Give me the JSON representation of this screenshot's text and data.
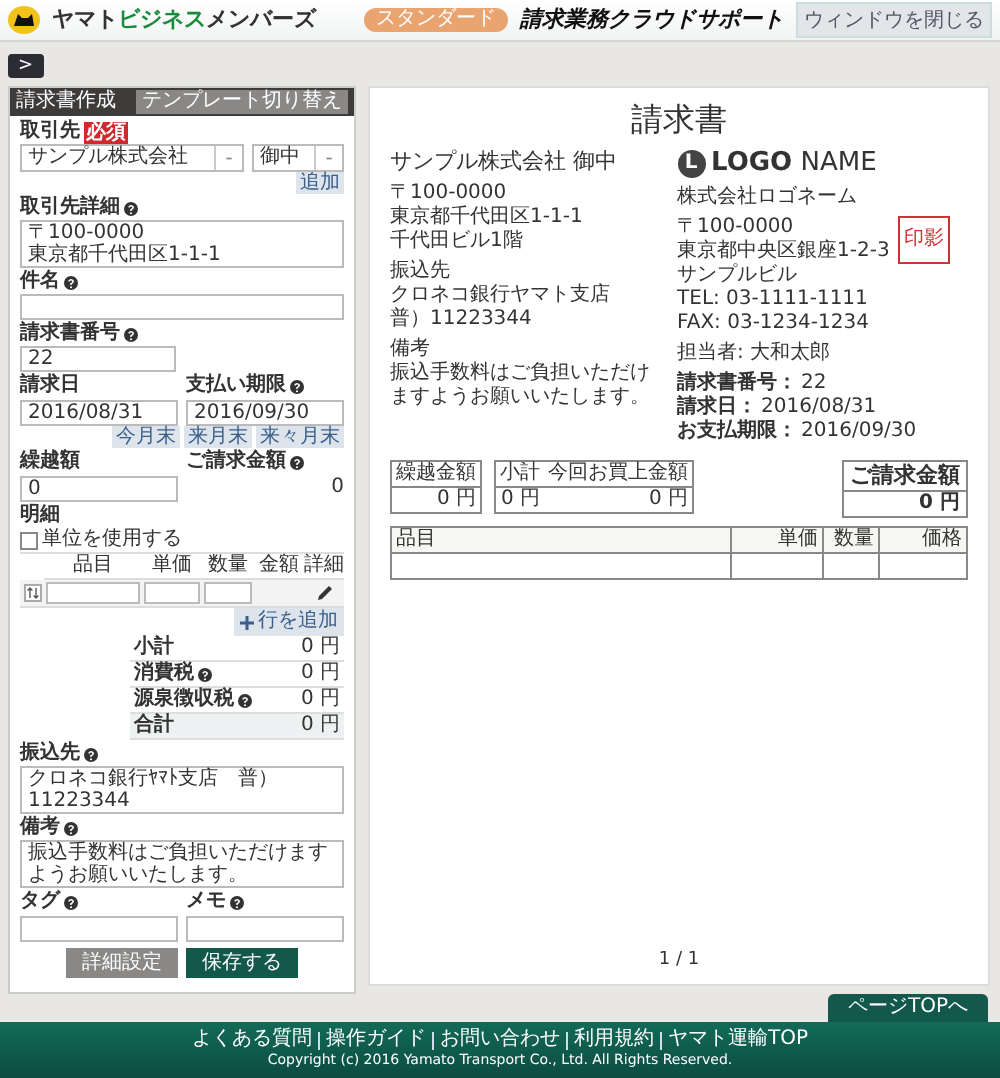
{
  "header": {
    "brand": [
      {
        "text": "ヤマト",
        "accent": false
      },
      {
        "text": "ビジネス",
        "accent": true
      },
      {
        "text": "メンバーズ",
        "accent": false
      }
    ],
    "plan": "スタンダード",
    "service": "請求業務クラウドサポート",
    "close_button": "ウィンドウを閉じる"
  },
  "panel_toggle": ">",
  "form": {
    "title": "請求書作成",
    "template_button": "テンプレート切り替え",
    "client": {
      "label": "取引先",
      "required": "必須",
      "value": "サンプル株式会社",
      "clear": "-",
      "suffix": "御中",
      "suffix_clear": "-",
      "add": "追加"
    },
    "client_detail": {
      "label": "取引先詳細",
      "help": true,
      "lines": [
        "〒100-0000",
        "東京都千代田区1-1-1"
      ]
    },
    "subject": {
      "label": "件名",
      "help": true
    },
    "invoice_number": {
      "label": "請求書番号",
      "help": true,
      "value": "22"
    },
    "invoice_date": {
      "label": "請求日",
      "help": false,
      "value": "2016/08/31"
    },
    "due_date": {
      "label": "支払い期限",
      "help": true,
      "value": "2016/09/30",
      "shortcuts": [
        "今月末",
        "来月末",
        "来々月末"
      ]
    },
    "carryover": {
      "label": "繰越額",
      "help": false,
      "value": "0"
    },
    "billing_total": {
      "label": "ご請求金額",
      "help": true,
      "value": "0"
    },
    "details": {
      "label": "明細",
      "unit_option": {
        "label": "単位を使用する",
        "checked": false
      },
      "columns": [
        "品目",
        "単価",
        "数量",
        "金額",
        "詳細"
      ],
      "add_row": "行を追加"
    },
    "totals": [
      {
        "label": "小計",
        "help": false,
        "value": "0 円",
        "kind": "normal"
      },
      {
        "label": "消費税",
        "help": true,
        "value": "0 円",
        "kind": "normal"
      },
      {
        "label": "源泉徴収税",
        "help": true,
        "value": "0 円",
        "kind": "normal"
      },
      {
        "label": "合計",
        "help": false,
        "value": "0 円",
        "kind": "total"
      }
    ],
    "bank": {
      "label": "振込先",
      "help": true,
      "value": "クロネコ銀行ﾔﾏﾄ支店　普）11223344"
    },
    "notes": {
      "label": "備考",
      "help": true,
      "value": "振込手数料はご負担いただけますようお願いいたします。"
    },
    "tag": {
      "label": "タグ",
      "help": true
    },
    "memo": {
      "label": "メモ",
      "help": true
    },
    "buttons": [
      {
        "label": "詳細設定",
        "kind": "secondary"
      },
      {
        "label": "保存する",
        "kind": "primary"
      }
    ]
  },
  "preview": {
    "title": "請求書",
    "recipient": "サンプル株式会社 御中",
    "address": [
      "〒100-0000",
      "東京都千代田区1-1-1",
      "千代田ビル1階"
    ],
    "bank_label": "振込先",
    "bank": [
      "クロネコ銀行ヤマト支店",
      "普）11223344"
    ],
    "notes_label": "備考",
    "notes": "振込手数料はご負担いただけますようお願いいたします。",
    "logo_letter": "L",
    "logo_bold": "LOGO",
    "logo_name": "NAME",
    "company": "株式会社ロゴネーム",
    "company_address": [
      "〒100-0000",
      "東京都中央区銀座1-2-3",
      "サンプルビル",
      "TEL: 03-1111-1111",
      "FAX: 03-1234-1234"
    ],
    "stamp": "印影",
    "staff": "担当者: 大和太郎",
    "info": [
      {
        "label": "請求書番号：",
        "value": "22"
      },
      {
        "label": "請求日：",
        "value": "2016/08/31"
      },
      {
        "label": "お支払期限：",
        "value": "2016/09/30"
      }
    ],
    "summary": [
      {
        "label": "繰越金額",
        "value": "0 円"
      },
      {
        "label": "小計",
        "value": "0 円"
      },
      {
        "label": "今回お買上金額",
        "value": "0 円"
      }
    ],
    "total": {
      "label": "ご請求金額",
      "value": "0 円"
    },
    "items_columns": [
      "品目",
      "単価",
      "数量",
      "価格"
    ],
    "page": "1 / 1"
  },
  "page_top": "ページTOPへ",
  "footer": {
    "links": [
      "よくある質問",
      "操作ガイド",
      "お問い合わせ",
      "利用規約",
      "ヤマト運輸TOP"
    ],
    "copyright": "Copyright (c) 2016 Yamato Transport Co., Ltd. All Rights Reserved."
  }
}
